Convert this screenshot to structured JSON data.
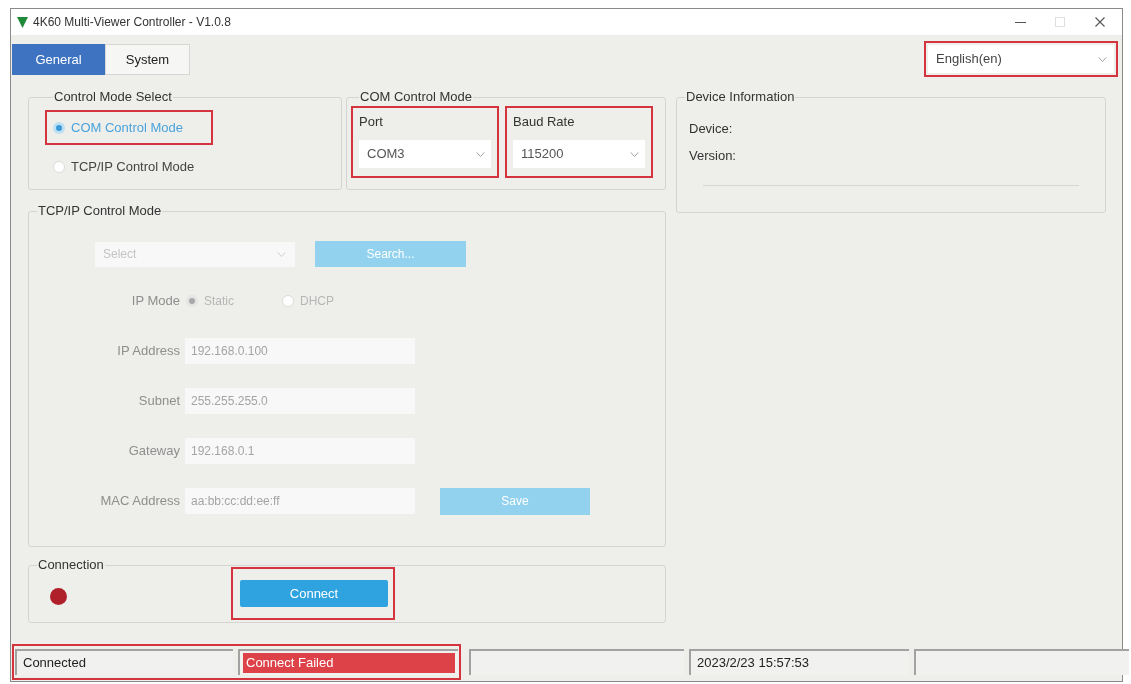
{
  "window": {
    "title": "4K60 Multi-Viewer Controller - V1.0.8",
    "controls": [
      {
        "kind": "minimize",
        "disabled": false
      },
      {
        "kind": "maximize",
        "disabled": true
      },
      {
        "kind": "close",
        "disabled": false
      }
    ]
  },
  "tabs": [
    {
      "label": "General",
      "selected": true
    },
    {
      "label": "System",
      "selected": false
    }
  ],
  "language": {
    "value": "English(en)",
    "highlighted": true
  },
  "control_mode_select": {
    "title": "Control Mode Select",
    "options": [
      {
        "label": "COM Control Mode",
        "selected": true,
        "highlighted": true
      },
      {
        "label": "TCP/IP Control Mode",
        "selected": false,
        "highlighted": false
      }
    ]
  },
  "com_control_mode": {
    "title": "COM Control Mode",
    "fields": [
      {
        "label": "Port",
        "value": "COM3",
        "highlighted": true
      },
      {
        "label": "Baud Rate",
        "value": "115200",
        "highlighted": true
      }
    ]
  },
  "device_information": {
    "title": "Device Information",
    "rows": [
      {
        "label": "Device:"
      },
      {
        "label": "Version:"
      }
    ]
  },
  "tcpip_control_mode": {
    "title": "TCP/IP Control Mode",
    "disabled": true,
    "device_select": {
      "placeholder": "Select"
    },
    "search_button": {
      "label": "Search..."
    },
    "ip_mode": {
      "label": "IP Mode",
      "options": [
        {
          "label": "Static",
          "selected": true
        },
        {
          "label": "DHCP",
          "selected": false
        }
      ]
    },
    "fields": [
      {
        "label": "IP Address",
        "value": "192.168.0.100"
      },
      {
        "label": "Subnet",
        "value": "255.255.255.0"
      },
      {
        "label": "Gateway",
        "value": "192.168.0.1"
      },
      {
        "label": "MAC Address",
        "value": "aa:bb:cc:dd:ee:ff",
        "button": "Save"
      }
    ]
  },
  "connection": {
    "title": "Connection",
    "connected": false,
    "connect_button": {
      "label": "Connect",
      "highlighted": true
    }
  },
  "status_bar": {
    "cells": [
      {
        "kind": "text",
        "text": "Connected",
        "highlighted": true
      },
      {
        "kind": "error",
        "text": "Connect Failed",
        "highlighted": true
      },
      {
        "kind": "blank",
        "highlighted": false
      },
      {
        "kind": "text",
        "text": "2023/2/23 15:57:53",
        "highlighted": false
      },
      {
        "kind": "blank",
        "highlighted": false
      }
    ]
  }
}
